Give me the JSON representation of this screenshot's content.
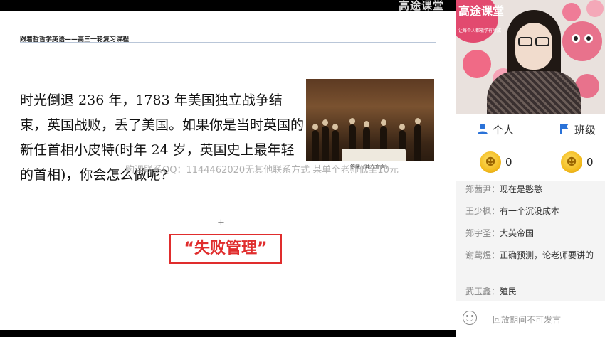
{
  "top_bar": {
    "logo": "高途课堂"
  },
  "slide": {
    "course_title": "跟着哲哲学英语——高三一轮复习课程",
    "body_text": "时光倒退 236 年，1783 年美国独立战争结束，英国战败，丢了美国。如果你是当时英国的新任首相小皮特(时年 24 岁，英国史上最年轻的首相)，你会怎么做呢?",
    "painting_caption": "签署《独立宣言》",
    "cursor_mark": "+",
    "stamp_text": "“失败管理”"
  },
  "watermark": "购课联系QQ：1144462020无其他联系方式 某单个老师低至10元",
  "video": {
    "logo": "高途课堂",
    "logo_sub": "让每个人都能学有所成"
  },
  "tabs": [
    {
      "label": "个人",
      "icon": "person-icon"
    },
    {
      "label": "班级",
      "icon": "flag-icon"
    }
  ],
  "coins": [
    {
      "count": "0",
      "icon": "coin-icon"
    },
    {
      "count": "0",
      "icon": "coin-icon"
    }
  ],
  "chat": {
    "messages": [
      {
        "name": "郑茜尹：",
        "text": "现在是憨憨"
      },
      {
        "name": "王少枫：",
        "text": "有一个沉没成本"
      },
      {
        "name": "郑宇圣：",
        "text": "大英帝国"
      },
      {
        "name": "谢莺煜：",
        "text": "正确预测，论老师要讲的"
      },
      {
        "name": "武玉鑫：",
        "text": "殖民"
      }
    ]
  },
  "input": {
    "hint": "回放期间不可发言",
    "icon": "emoji-icon"
  },
  "colors": {
    "accent_blue": "#2a72d8",
    "stamp_red": "#e02d2d",
    "coin_gold": "#f2b91b"
  }
}
